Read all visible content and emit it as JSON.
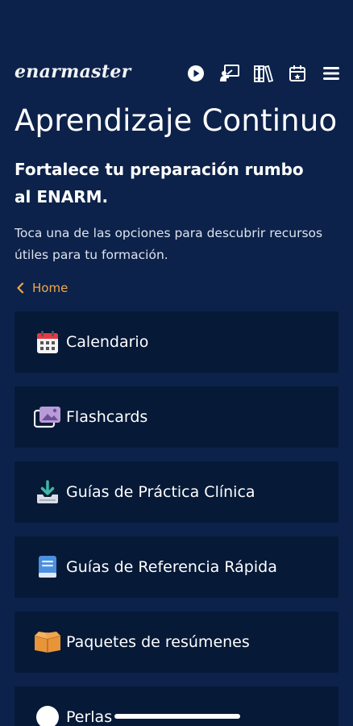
{
  "header": {
    "logo_text": "enarmaster",
    "nav_icons": [
      "play-icon",
      "teacher-board-icon",
      "books-icon",
      "calendar-icon",
      "hamburger-menu-icon"
    ]
  },
  "page": {
    "title": "Aprendizaje Continuo",
    "subtitle": "Fortalece tu preparación rumbo al ENARM.",
    "description": "Toca una de las opciones para descubrir recursos útiles para tu formación.",
    "back_label": "Home"
  },
  "menu": {
    "items": [
      {
        "label": "Calendario",
        "icon": "calendar-icon"
      },
      {
        "label": "Flashcards",
        "icon": "flashcards-icon"
      },
      {
        "label": "Guías de Práctica Clínica",
        "icon": "download-tray-icon"
      },
      {
        "label": "Guías de Referencia Rápida",
        "icon": "book-icon"
      },
      {
        "label": "Paquetes de resúmenes",
        "icon": "package-box-icon"
      },
      {
        "label": "Perlas",
        "icon": "pearl-icon"
      }
    ]
  },
  "colors": {
    "background": "#0c224a",
    "card_background": "#061937",
    "accent_link": "#f0a84a",
    "calendar_red": "#e23b45",
    "book_blue": "#4a8fe0",
    "package_orange": "#e8953a",
    "download_teal": "#3fb6a6"
  }
}
